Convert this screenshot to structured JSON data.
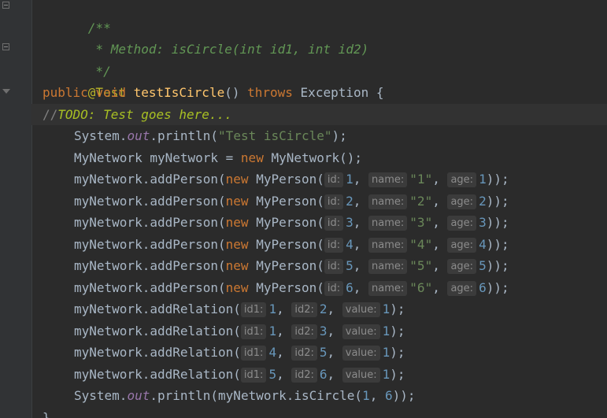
{
  "doc": {
    "open": "/**",
    "method": " * Method: isCircle(int id1, int id2)",
    "close": " */"
  },
  "annotation": "@Test",
  "sig": {
    "kw1": "public",
    "kw2": "void",
    "name": "testIsCircle",
    "parens": "()",
    "throws": "throws",
    "exc": "Exception {"
  },
  "todo": {
    "slashes": "//",
    "text": "TODO: Test goes here..."
  },
  "print1": {
    "obj": "System.",
    "field": "out",
    "call": ".println(",
    "str": "\"Test isCircle\"",
    "end": ");"
  },
  "decl": {
    "type": "MyNetwork myNetwork = ",
    "kw": "new",
    "ctor": " MyNetwork();"
  },
  "hints": {
    "id": "id:",
    "name": "name:",
    "age": "age:",
    "id1": "id1:",
    "id2": "id2:",
    "value": "value:"
  },
  "persons": [
    {
      "id": "1",
      "name": "\"1\"",
      "age": "1"
    },
    {
      "id": "2",
      "name": "\"2\"",
      "age": "2"
    },
    {
      "id": "3",
      "name": "\"3\"",
      "age": "3"
    },
    {
      "id": "4",
      "name": "\"4\"",
      "age": "4"
    },
    {
      "id": "5",
      "name": "\"5\"",
      "age": "5"
    },
    {
      "id": "6",
      "name": "\"6\"",
      "age": "6"
    }
  ],
  "addPerson": {
    "call": "myNetwork.addPerson(",
    "kw": "new",
    "ctor": " MyPerson(",
    "end": "));"
  },
  "relations": [
    {
      "id1": "1",
      "id2": "2",
      "value": "1"
    },
    {
      "id1": "1",
      "id2": "3",
      "value": "1"
    },
    {
      "id1": "4",
      "id2": "5",
      "value": "1"
    },
    {
      "id1": "5",
      "id2": "6",
      "value": "1"
    }
  ],
  "addRelation": {
    "call": "myNetwork.addRelation(",
    "end": ");"
  },
  "sep": ", ",
  "print2": {
    "obj": "System.",
    "field": "out",
    "call": ".println(myNetwork.isCircle(",
    "a1": "1",
    "sep": ", ",
    "a2": "6",
    "end": "));"
  },
  "closing": "}"
}
